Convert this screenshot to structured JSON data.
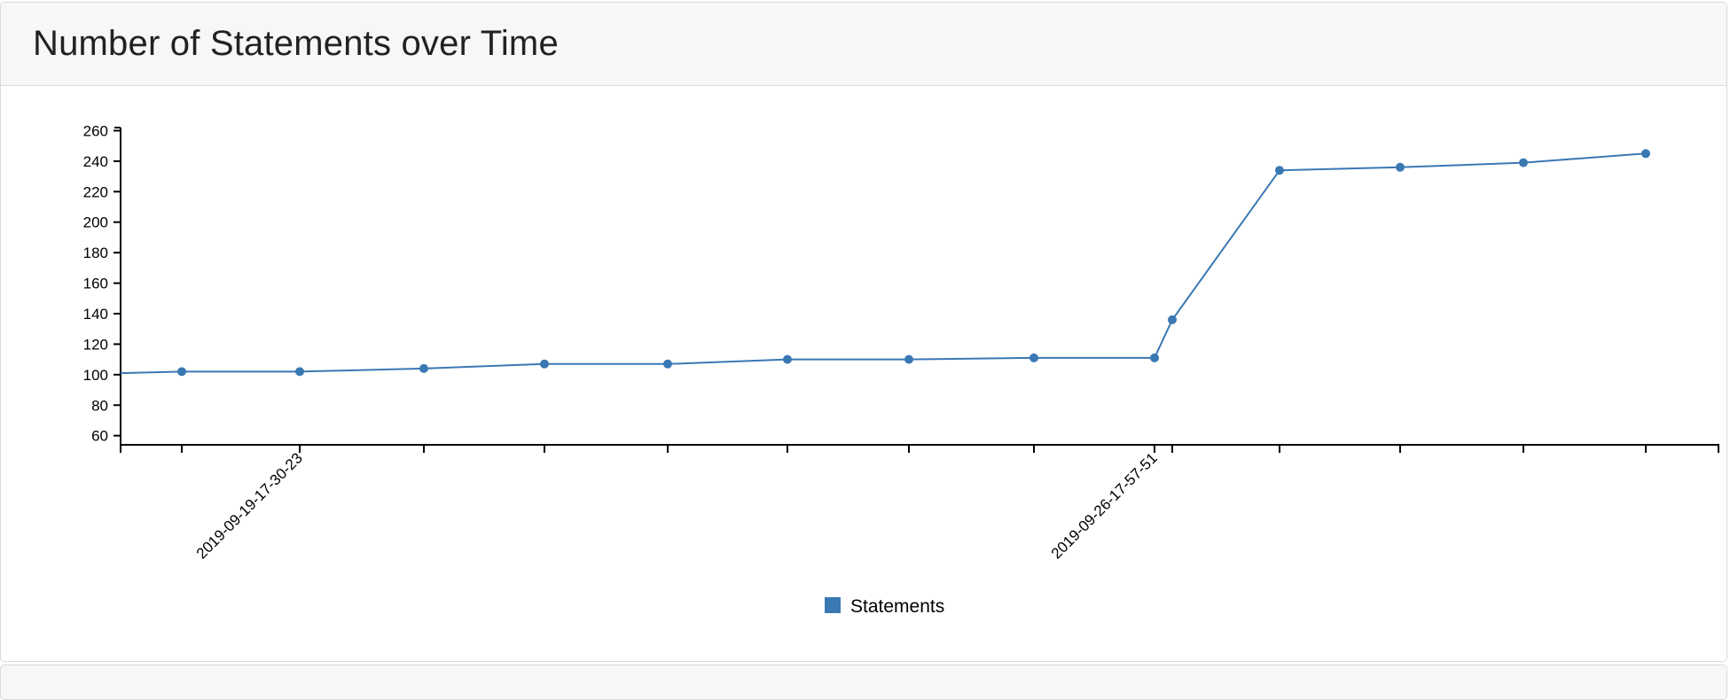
{
  "card": {
    "title": "Number of Statements over Time"
  },
  "chart_data": {
    "type": "line",
    "title": "Number of Statements over Time",
    "xlabel": "",
    "ylabel": "",
    "x_tick_labels": [
      "2019-09-19-17-30-23",
      "2019-09-26-17-57-51"
    ],
    "ylim": [
      54,
      262
    ],
    "y_ticks": [
      60,
      80,
      100,
      120,
      140,
      160,
      180,
      200,
      220,
      240,
      260
    ],
    "grid": false,
    "legend_position": "bottom-center",
    "series": [
      {
        "name": "Statements",
        "color": "#3a78b4",
        "values": [
          101,
          102,
          102,
          104,
          107,
          107,
          110,
          110,
          111,
          111,
          136,
          234,
          236,
          239,
          245
        ]
      }
    ]
  }
}
